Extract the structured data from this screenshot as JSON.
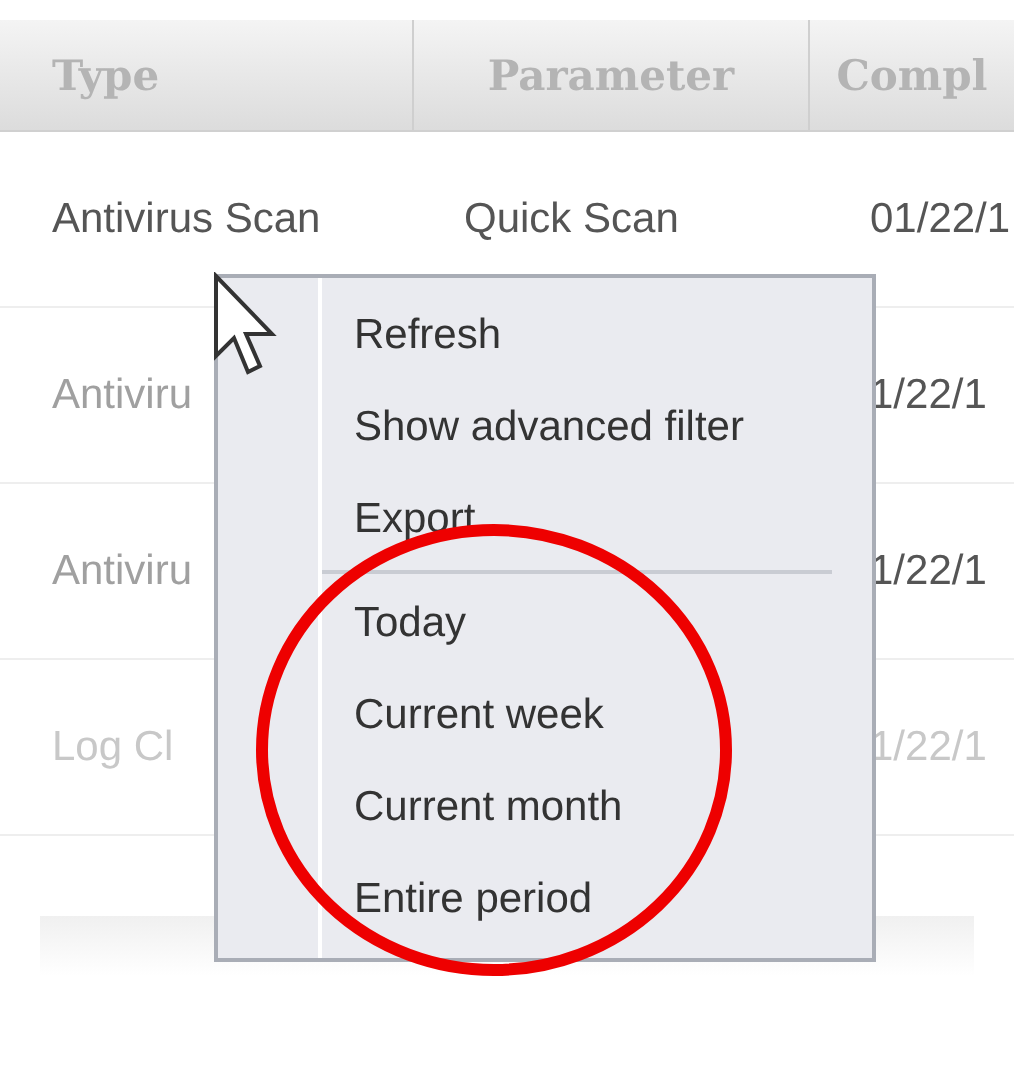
{
  "table": {
    "columns": [
      "Type",
      "Parameter",
      "Compl"
    ],
    "rows": [
      {
        "cells": [
          "Antivirus Scan",
          "Quick Scan",
          "01/22/1"
        ],
        "faded": false
      },
      {
        "cells": [
          "Antiviru",
          "",
          "1/22/1"
        ],
        "faded": false
      },
      {
        "cells": [
          "Antiviru",
          "",
          "1/22/1"
        ],
        "faded": false
      },
      {
        "cells": [
          "Log Cl",
          "",
          "1/22/1"
        ],
        "faded": true
      }
    ]
  },
  "context_menu": {
    "items": [
      {
        "kind": "item",
        "label": "Refresh"
      },
      {
        "kind": "item",
        "label": "Show advanced filter"
      },
      {
        "kind": "item",
        "label": "Export"
      },
      {
        "kind": "separator"
      },
      {
        "kind": "item",
        "label": "Today"
      },
      {
        "kind": "item",
        "label": "Current week"
      },
      {
        "kind": "item",
        "label": "Current month"
      },
      {
        "kind": "item",
        "label": "Entire period"
      }
    ]
  }
}
